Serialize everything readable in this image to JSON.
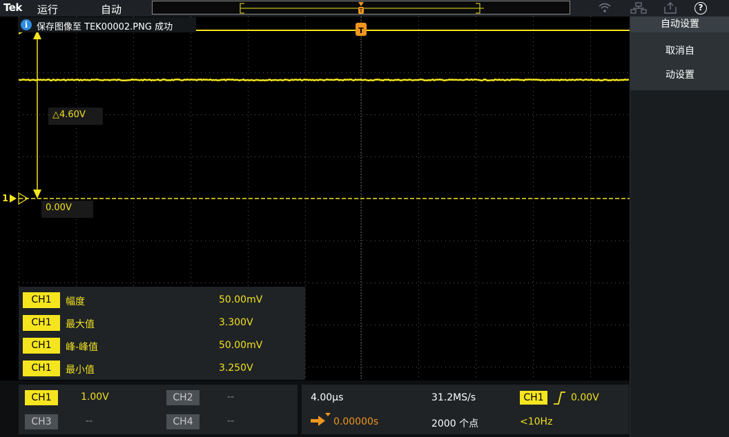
{
  "topbar": {
    "logo": "Tek",
    "run_state": "运行",
    "trigger_mode": "自动",
    "wifi_icon": "wifi-icon",
    "network_icon": "network-icon",
    "export_icon": "export-icon",
    "help_label": "?"
  },
  "message": {
    "icon": "info-icon",
    "icon_glyph": "i",
    "text": "保存图像至 TEK00002.PNG 成功"
  },
  "cursors": {
    "delta_label": "△4.60V",
    "zero_label": "0.00V"
  },
  "channel_marker": {
    "label": "1"
  },
  "measurements": [
    {
      "channel": "CH1",
      "name": "幅度",
      "value": "50.00mV"
    },
    {
      "channel": "CH1",
      "name": "最大值",
      "value": "3.300V"
    },
    {
      "channel": "CH1",
      "name": "峰-峰值",
      "value": "50.00mV"
    },
    {
      "channel": "CH1",
      "name": "最小值",
      "value": "3.250V"
    }
  ],
  "side_panel": {
    "title": "自动设置",
    "undo_line1": "取消自",
    "undo_line2": "动设置"
  },
  "channels": {
    "ch1": {
      "label": "CH1",
      "scale": "1.00V",
      "color": "#f5e51e"
    },
    "ch2": {
      "label": "CH2",
      "scale": "--"
    },
    "ch3": {
      "label": "CH3",
      "scale": "--"
    },
    "ch4": {
      "label": "CH4",
      "scale": "--"
    }
  },
  "horizontal": {
    "time_scale": "4.00µs",
    "position": "0.00000s",
    "sample_rate": "31.2MS/s",
    "record_length": "2000 个点"
  },
  "trigger": {
    "source": "CH1",
    "slope_icon": "rising-edge-icon",
    "level": "0.00V",
    "frequency": "<10Hz"
  },
  "colors": {
    "trace": "#f5e51e",
    "accent_orange": "#f0961e",
    "panel": "#1f2326"
  }
}
